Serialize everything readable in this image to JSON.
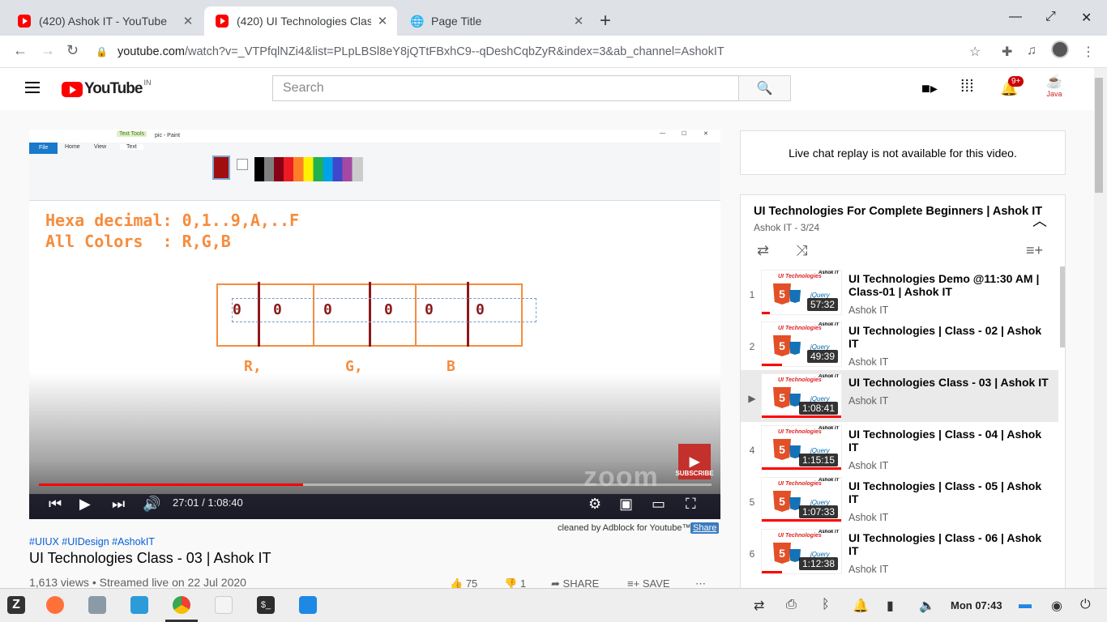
{
  "browser": {
    "tabs": [
      {
        "title": "(420) Ashok IT - YouTube",
        "favicon": "youtube-icon"
      },
      {
        "title": "(420) UI Technologies Class - 03 | Ashok IT",
        "favicon": "youtube-icon",
        "active": true
      },
      {
        "title": "Page Title",
        "favicon": "globe-icon"
      }
    ],
    "url_host": "youtube.com",
    "url_path": "/watch?v=_VTPfqlNZi4&list=PLpLBSl8eY8jQTtFBxhC9--qDeshCqbZyR&index=3&ab_channel=AshokIT"
  },
  "youtube": {
    "logo_text": "YouTube",
    "country_code": "IN",
    "search_placeholder": "Search",
    "notifications_badge": "9+",
    "avatar_label": "Java"
  },
  "video": {
    "paint_window_title": "pic - Paint",
    "ribbon_tabs": [
      "File",
      "Home",
      "View",
      "Text"
    ],
    "ribbon_context": "Text Tools",
    "canvas_line1": "Hexa decimal: 0,1..9,A,..F",
    "canvas_line2": "All Colors  : R,G,B",
    "canvas_zeros": [
      "0",
      "0",
      "0",
      "0",
      "0",
      "0"
    ],
    "canvas_labels": [
      "R,",
      "G,",
      "B"
    ],
    "current_time": "27:01",
    "duration": "1:08:40",
    "progress": 0.393,
    "subscribe_label": "SUBSCRIBE",
    "watermark": "zoom"
  },
  "below_video": {
    "adblock_note": "cleaned by Adblock for Youtube™",
    "share_label": "Share",
    "hashtags": "#UIUX #UIDesign #AshokIT",
    "title": "UI Technologies Class - 03 | Ashok IT",
    "meta": "1,613 views • Streamed live on 22 Jul 2020",
    "likes": "75",
    "dislikes": "1",
    "share": "SHARE",
    "save": "SAVE"
  },
  "chat": {
    "message": "Live chat replay is not available for this video."
  },
  "playlist": {
    "title": "UI Technologies For Complete Beginners | Ashok IT",
    "subtitle": "Ashok IT - 3/24",
    "items": [
      {
        "index": "1",
        "title": "UI Technologies Demo @11:30 AM | Class-01 | Ashok IT",
        "channel": "Ashok IT",
        "duration": "57:32",
        "watched": 0.1
      },
      {
        "index": "2",
        "title": "UI Technologies | Class - 02 | Ashok IT",
        "channel": "Ashok IT",
        "duration": "49:39",
        "watched": 0.25
      },
      {
        "index": "▶",
        "title": "UI Technologies Class - 03 | Ashok IT",
        "channel": "Ashok IT",
        "duration": "1:08:41",
        "watched": 1.0,
        "active": true
      },
      {
        "index": "4",
        "title": "UI Technologies | Class - 04 | Ashok IT",
        "channel": "Ashok IT",
        "duration": "1:15:15",
        "watched": 1.0
      },
      {
        "index": "5",
        "title": "UI Technologies | Class - 05 | Ashok IT",
        "channel": "Ashok IT",
        "duration": "1:07:33",
        "watched": 1.0
      },
      {
        "index": "6",
        "title": "UI Technologies | Class - 06 | Ashok IT",
        "channel": "Ashok IT",
        "duration": "1:12:38",
        "watched": 0.25
      }
    ],
    "thumb_brand": "UI Technologies",
    "thumb_author": "Ashok IT"
  },
  "taskbar": {
    "clock": "Mon 07:43"
  }
}
